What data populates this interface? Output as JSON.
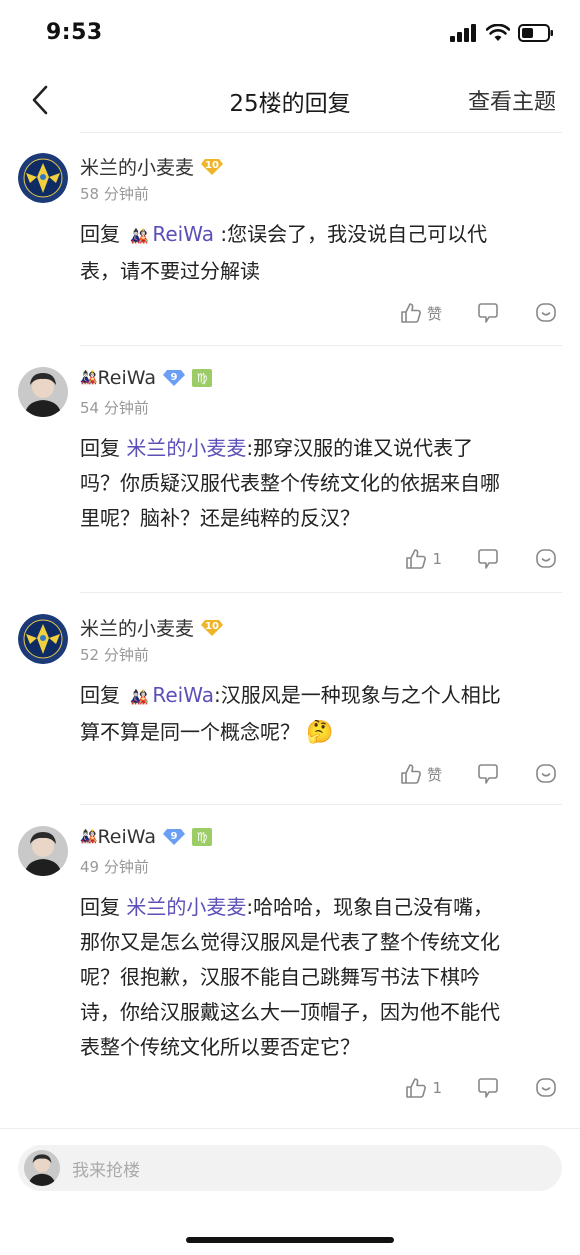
{
  "status_bar": {
    "time": "9:53"
  },
  "nav": {
    "title": "25楼的回复",
    "action": "查看主题"
  },
  "reply_prefix": "回复",
  "comments": [
    {
      "user": "米兰的小麦麦",
      "level": "10",
      "time": "58 分钟前",
      "mention": "ReiWa",
      "text_1": ":您误会了，我没说自己可以代",
      "text_2": "表，请不要过分解读",
      "like_label": "赞"
    },
    {
      "user": "ReiWa",
      "level": "9",
      "zodiac": "♍",
      "time": "54 分钟前",
      "mention": "米兰的小麦麦",
      "text_1": ":那穿汉服的谁又说代表了",
      "text_2": "吗？你质疑汉服代表整个传统文化的依据来自哪",
      "text_3": "里呢？脑补？还是纯粹的反汉？",
      "like_label": "1"
    },
    {
      "user": "米兰的小麦麦",
      "level": "10",
      "time": "52 分钟前",
      "mention": "ReiWa",
      "text_1": ":汉服风是一种现象与之个人相比",
      "text_2": "算不算是同一个概念呢？",
      "emoji": "🤔",
      "like_label": "赞"
    },
    {
      "user": "ReiWa",
      "level": "9",
      "zodiac": "♍",
      "time": "49 分钟前",
      "mention": "米兰的小麦麦",
      "text_1": ":哈哈哈，现象自己没有嘴，",
      "text_2": "那你又是怎么觉得汉服风是代表了整个传统文化",
      "text_3": "呢？很抱歉，汉服不能自己跳舞写书法下棋吟",
      "text_4": "诗，你给汉服戴这么大一顶帽子，因为他不能代",
      "text_5": "表整个传统文化所以要否定它？",
      "like_label": "1"
    }
  ],
  "input": {
    "placeholder": "我来抢楼"
  },
  "colors": {
    "mention": "#5b4fb8",
    "gold_badge": "#f0b429",
    "blue_badge": "#6a9ff5",
    "zodiac": "#9ccc65"
  }
}
